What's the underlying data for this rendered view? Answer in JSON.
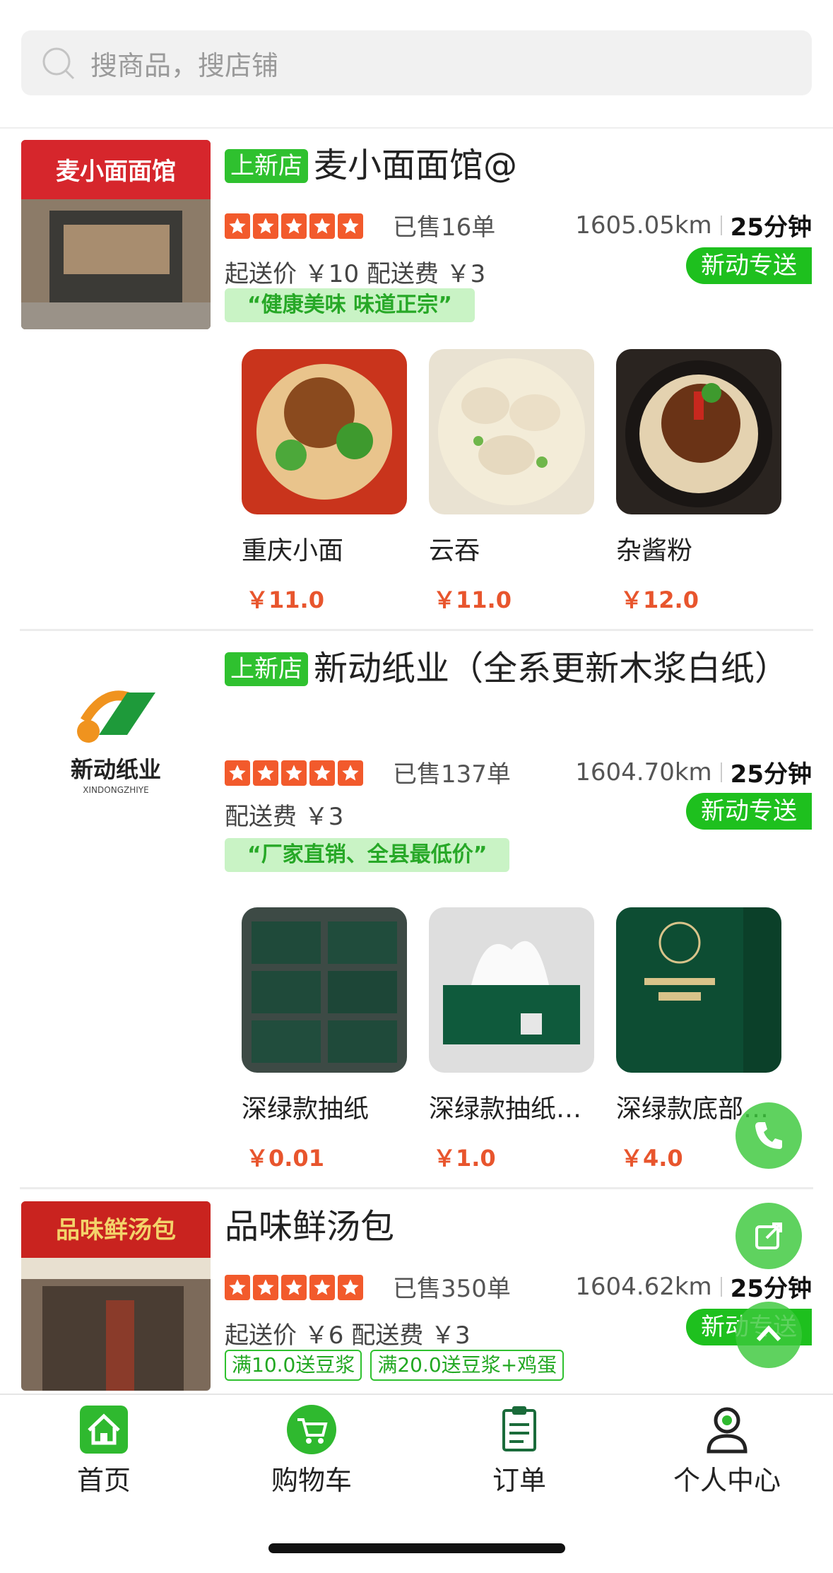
{
  "search": {
    "placeholder": "搜商品，搜店铺"
  },
  "stores": [
    {
      "badge": "上新店",
      "name": "麦小面面馆@",
      "sold": "已售16单",
      "distance": "1605.05km",
      "eta": "25分钟",
      "fees": "起送价 ￥10  配送费 ￥3",
      "express": "新动专送",
      "slogan": "“健康美味 味道正宗”",
      "shop_sign": "麦小面面馆",
      "products": [
        {
          "name": "重庆小面",
          "price": "￥11.0"
        },
        {
          "name": "云吞",
          "price": "￥11.0"
        },
        {
          "name": "杂酱粉",
          "price": "￥12.0"
        }
      ]
    },
    {
      "badge": "上新店",
      "name": "新动纸业（全系更新木浆白纸）",
      "sold": "已售137单",
      "distance": "1604.70km",
      "eta": "25分钟",
      "fees": "配送费 ￥3",
      "express": "新动专送",
      "slogan": "“厂家直销、全县最低价”",
      "logo_text": "新动纸业",
      "logo_sub": "XINDONGZHIYE",
      "products": [
        {
          "name": "深绿款抽纸",
          "price": "￥0.01"
        },
        {
          "name": "深绿款抽纸…",
          "price": "￥1.0"
        },
        {
          "name": "深绿款底部…",
          "price": "￥4.0"
        }
      ]
    },
    {
      "name": "品味鲜汤包",
      "sold": "已售350单",
      "distance": "1604.62km",
      "eta": "25分钟",
      "fees": "起送价 ￥6  配送费 ￥3",
      "express": "新动专送",
      "shop_sign": "品味鲜汤包",
      "promos": [
        "满10.0送豆浆",
        "满20.0送豆浆+鸡蛋"
      ]
    }
  ],
  "tabs": [
    {
      "label": "首页",
      "icon": "home-icon",
      "active": true
    },
    {
      "label": "购物车",
      "icon": "cart-icon"
    },
    {
      "label": "订单",
      "icon": "order-icon"
    },
    {
      "label": "个人中心",
      "icon": "profile-icon"
    }
  ],
  "colors": {
    "brand_green": "#1ec01e",
    "price_red": "#e8552d",
    "star_orange": "#f25a2c"
  }
}
